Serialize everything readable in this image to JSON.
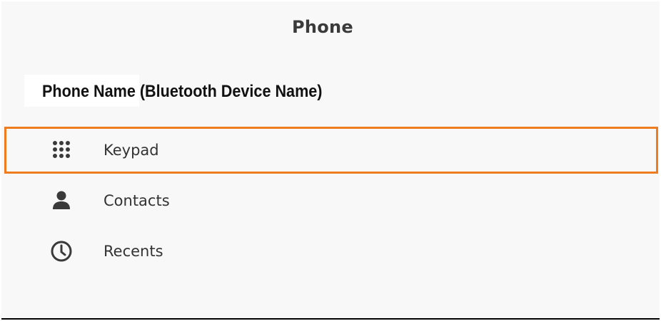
{
  "header": {
    "title": "Phone"
  },
  "device": {
    "name": "Phone Name (Bluetooth Device Name)"
  },
  "menu": {
    "items": [
      {
        "label": "Keypad",
        "icon": "keypad-icon",
        "highlighted": true
      },
      {
        "label": "Contacts",
        "icon": "person-icon",
        "highlighted": false
      },
      {
        "label": "Recents",
        "icon": "clock-icon",
        "highlighted": false
      }
    ]
  },
  "colors": {
    "background": "#f8f8f8",
    "highlight": "#ee7d22",
    "text": "#333333",
    "icon": "#3a3a3a"
  }
}
